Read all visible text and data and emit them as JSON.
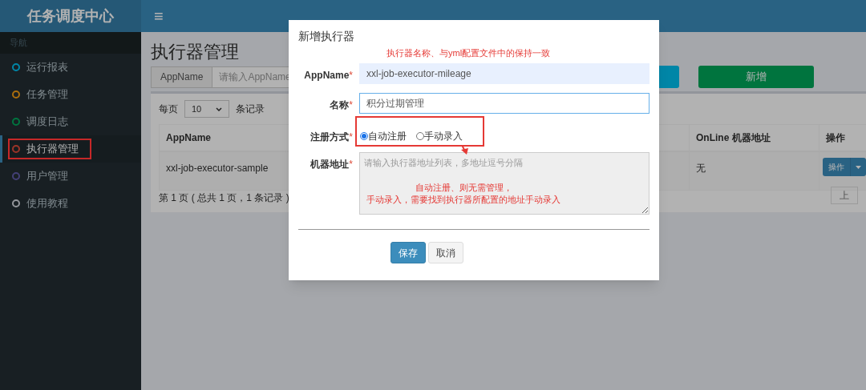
{
  "app": {
    "brand": "任务调度中心",
    "menu_toggle": "≡"
  },
  "sidebar": {
    "header": "导航",
    "items": [
      {
        "label": "运行报表",
        "color": "#0086a7",
        "selected": false,
        "boxed": false
      },
      {
        "label": "任务管理",
        "color": "#aa6d0d",
        "selected": false,
        "boxed": false
      },
      {
        "label": "调度日志",
        "color": "#00743f",
        "selected": false,
        "boxed": false
      },
      {
        "label": "执行器管理",
        "color": "#9b3428",
        "selected": true,
        "boxed": true
      },
      {
        "label": "用户管理",
        "color": "#434076",
        "selected": false,
        "boxed": false
      },
      {
        "label": "使用教程",
        "color": "#93969b",
        "selected": false,
        "boxed": false
      }
    ]
  },
  "page": {
    "title": "执行器管理",
    "search": {
      "label": "AppName",
      "placeholder": "请输入AppName"
    },
    "add_button": "新增",
    "page_size": {
      "prefix": "每页",
      "value": "10",
      "suffix": "条记录"
    },
    "table": {
      "columns": [
        "AppName",
        "OnLine 机器地址",
        "操作"
      ],
      "rows": [
        {
          "cells": [
            "xxl-job-executor-sample",
            "无"
          ],
          "action": "操作"
        }
      ]
    },
    "pagination_info": "第 1 页 ( 总共 1 页，1 条记录 )",
    "pager_button": "上"
  },
  "modal": {
    "title": "新增执行器",
    "fields": [
      {
        "kind": "text",
        "label": "AppName",
        "required_mark": "*",
        "value": "xxl-job-executor-mileage",
        "autofilled": true,
        "focused": false
      },
      {
        "kind": "text",
        "label": "名称",
        "required_mark": "*",
        "value": "积分过期管理",
        "autofilled": false,
        "focused": true
      },
      {
        "kind": "radio",
        "label": "注册方式",
        "required_mark": "*",
        "options": [
          {
            "label": "自动注册",
            "selected": true
          },
          {
            "label": "手动录入",
            "selected": false
          }
        ]
      },
      {
        "kind": "textarea",
        "label": "机器地址",
        "required_mark": "*",
        "placeholder": "请输入执行器地址列表，多地址逗号分隔",
        "disabled": true
      }
    ],
    "buttons": [
      {
        "label": "保存",
        "kind": "primary"
      },
      {
        "label": "取消",
        "kind": "default"
      }
    ]
  },
  "annotations": {
    "name_note": "执行器名称、与yml配置文件中的保持一致",
    "address_note": [
      "自动注册、则无需管理，",
      "手动录入，需要找到执行器所配置的地址手动录入"
    ]
  }
}
